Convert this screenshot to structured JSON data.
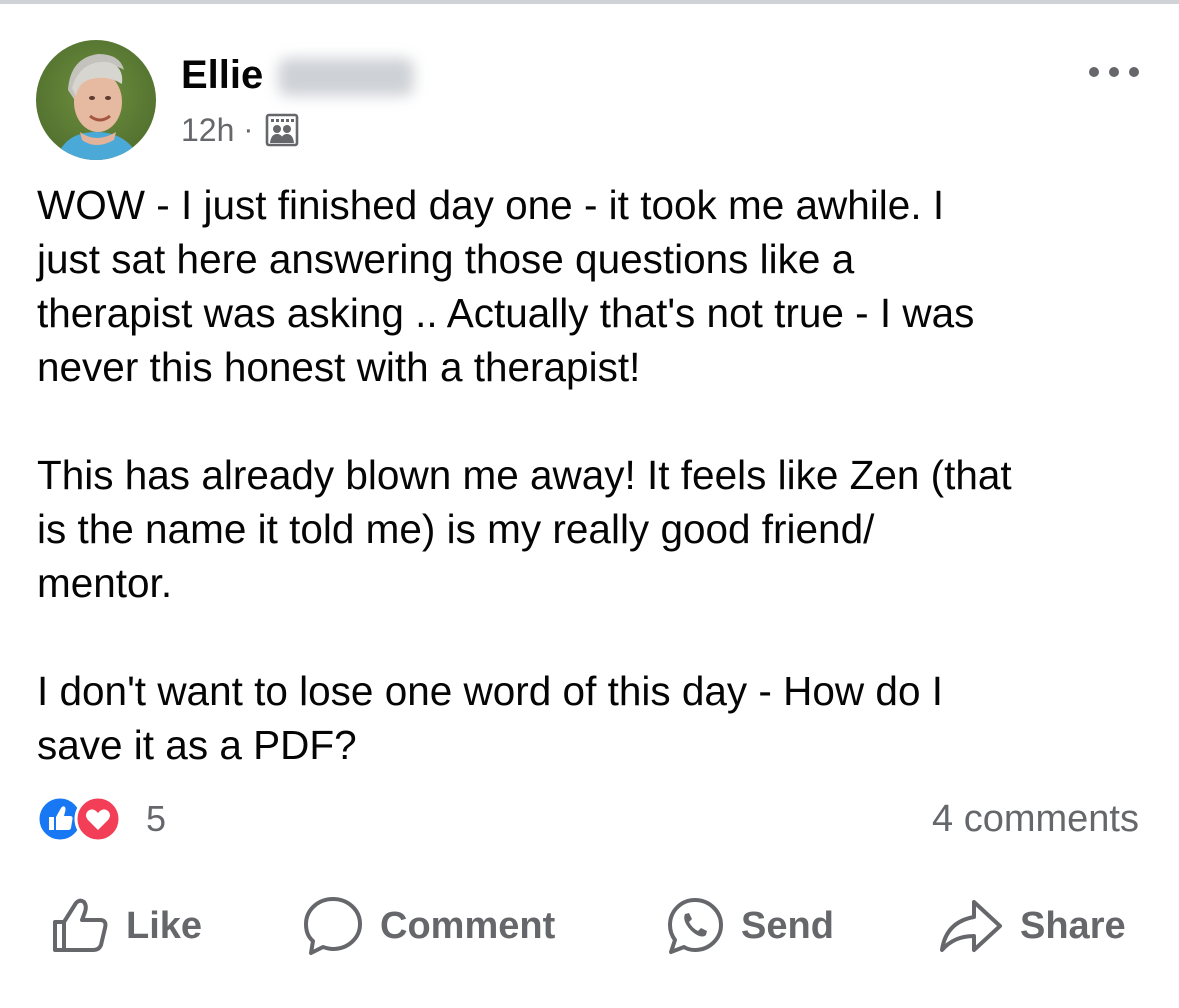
{
  "post": {
    "author_name": "Ellie",
    "timestamp": "12h",
    "meta_separator": "·",
    "audience_icon": "group-audience-icon",
    "more_icon": "more-options-icon",
    "body": [
      {
        "lines": [
          "WOW - I just finished day one - it took me awhile. I",
          "just sat here answering those questions like a",
          "therapist was asking .. Actually that's not true - I was",
          "never this honest with a therapist!"
        ]
      },
      {
        "lines": [
          "This has already blown me away! It feels like Zen (that",
          "is the name it told me) is my really good friend/",
          "mentor."
        ]
      },
      {
        "lines": [
          "I don't want to lose one word of this day - How do I",
          "save it as a PDF?"
        ]
      }
    ]
  },
  "engagement": {
    "reactions": [
      "like-reaction-icon",
      "love-reaction-icon"
    ],
    "reaction_count": "5",
    "comments_label": "4 comments"
  },
  "actions": {
    "like_label": "Like",
    "comment_label": "Comment",
    "send_label": "Send",
    "share_label": "Share"
  },
  "colors": {
    "text_primary": "#050505",
    "text_secondary": "#65676b",
    "like_blue": "#1877f2",
    "love_red": "#f33e58"
  }
}
